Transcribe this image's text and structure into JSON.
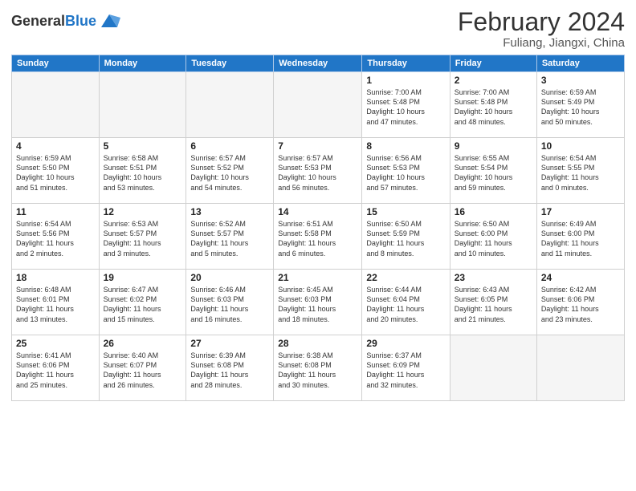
{
  "logo": {
    "general": "General",
    "blue": "Blue"
  },
  "header": {
    "month": "February 2024",
    "location": "Fuliang, Jiangxi, China"
  },
  "weekdays": [
    "Sunday",
    "Monday",
    "Tuesday",
    "Wednesday",
    "Thursday",
    "Friday",
    "Saturday"
  ],
  "weeks": [
    [
      {
        "day": "",
        "info": "",
        "empty": true
      },
      {
        "day": "",
        "info": "",
        "empty": true
      },
      {
        "day": "",
        "info": "",
        "empty": true
      },
      {
        "day": "",
        "info": "",
        "empty": true
      },
      {
        "day": "1",
        "info": "Sunrise: 7:00 AM\nSunset: 5:48 PM\nDaylight: 10 hours\nand 47 minutes."
      },
      {
        "day": "2",
        "info": "Sunrise: 7:00 AM\nSunset: 5:48 PM\nDaylight: 10 hours\nand 48 minutes."
      },
      {
        "day": "3",
        "info": "Sunrise: 6:59 AM\nSunset: 5:49 PM\nDaylight: 10 hours\nand 50 minutes."
      }
    ],
    [
      {
        "day": "4",
        "info": "Sunrise: 6:59 AM\nSunset: 5:50 PM\nDaylight: 10 hours\nand 51 minutes."
      },
      {
        "day": "5",
        "info": "Sunrise: 6:58 AM\nSunset: 5:51 PM\nDaylight: 10 hours\nand 53 minutes."
      },
      {
        "day": "6",
        "info": "Sunrise: 6:57 AM\nSunset: 5:52 PM\nDaylight: 10 hours\nand 54 minutes."
      },
      {
        "day": "7",
        "info": "Sunrise: 6:57 AM\nSunset: 5:53 PM\nDaylight: 10 hours\nand 56 minutes."
      },
      {
        "day": "8",
        "info": "Sunrise: 6:56 AM\nSunset: 5:53 PM\nDaylight: 10 hours\nand 57 minutes."
      },
      {
        "day": "9",
        "info": "Sunrise: 6:55 AM\nSunset: 5:54 PM\nDaylight: 10 hours\nand 59 minutes."
      },
      {
        "day": "10",
        "info": "Sunrise: 6:54 AM\nSunset: 5:55 PM\nDaylight: 11 hours\nand 0 minutes."
      }
    ],
    [
      {
        "day": "11",
        "info": "Sunrise: 6:54 AM\nSunset: 5:56 PM\nDaylight: 11 hours\nand 2 minutes."
      },
      {
        "day": "12",
        "info": "Sunrise: 6:53 AM\nSunset: 5:57 PM\nDaylight: 11 hours\nand 3 minutes."
      },
      {
        "day": "13",
        "info": "Sunrise: 6:52 AM\nSunset: 5:57 PM\nDaylight: 11 hours\nand 5 minutes."
      },
      {
        "day": "14",
        "info": "Sunrise: 6:51 AM\nSunset: 5:58 PM\nDaylight: 11 hours\nand 6 minutes."
      },
      {
        "day": "15",
        "info": "Sunrise: 6:50 AM\nSunset: 5:59 PM\nDaylight: 11 hours\nand 8 minutes."
      },
      {
        "day": "16",
        "info": "Sunrise: 6:50 AM\nSunset: 6:00 PM\nDaylight: 11 hours\nand 10 minutes."
      },
      {
        "day": "17",
        "info": "Sunrise: 6:49 AM\nSunset: 6:00 PM\nDaylight: 11 hours\nand 11 minutes."
      }
    ],
    [
      {
        "day": "18",
        "info": "Sunrise: 6:48 AM\nSunset: 6:01 PM\nDaylight: 11 hours\nand 13 minutes."
      },
      {
        "day": "19",
        "info": "Sunrise: 6:47 AM\nSunset: 6:02 PM\nDaylight: 11 hours\nand 15 minutes."
      },
      {
        "day": "20",
        "info": "Sunrise: 6:46 AM\nSunset: 6:03 PM\nDaylight: 11 hours\nand 16 minutes."
      },
      {
        "day": "21",
        "info": "Sunrise: 6:45 AM\nSunset: 6:03 PM\nDaylight: 11 hours\nand 18 minutes."
      },
      {
        "day": "22",
        "info": "Sunrise: 6:44 AM\nSunset: 6:04 PM\nDaylight: 11 hours\nand 20 minutes."
      },
      {
        "day": "23",
        "info": "Sunrise: 6:43 AM\nSunset: 6:05 PM\nDaylight: 11 hours\nand 21 minutes."
      },
      {
        "day": "24",
        "info": "Sunrise: 6:42 AM\nSunset: 6:06 PM\nDaylight: 11 hours\nand 23 minutes."
      }
    ],
    [
      {
        "day": "25",
        "info": "Sunrise: 6:41 AM\nSunset: 6:06 PM\nDaylight: 11 hours\nand 25 minutes."
      },
      {
        "day": "26",
        "info": "Sunrise: 6:40 AM\nSunset: 6:07 PM\nDaylight: 11 hours\nand 26 minutes."
      },
      {
        "day": "27",
        "info": "Sunrise: 6:39 AM\nSunset: 6:08 PM\nDaylight: 11 hours\nand 28 minutes."
      },
      {
        "day": "28",
        "info": "Sunrise: 6:38 AM\nSunset: 6:08 PM\nDaylight: 11 hours\nand 30 minutes."
      },
      {
        "day": "29",
        "info": "Sunrise: 6:37 AM\nSunset: 6:09 PM\nDaylight: 11 hours\nand 32 minutes."
      },
      {
        "day": "",
        "info": "",
        "empty": true
      },
      {
        "day": "",
        "info": "",
        "empty": true
      }
    ]
  ]
}
